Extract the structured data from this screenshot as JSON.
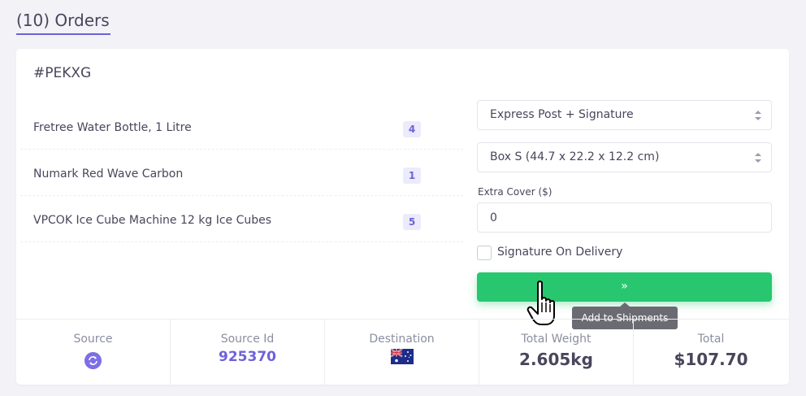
{
  "header": {
    "title": "(10) Orders"
  },
  "order": {
    "id": "#PEKXG",
    "items": [
      {
        "name": "Fretree Water Bottle, 1 Litre",
        "qty": "4"
      },
      {
        "name": "Numark Red Wave Carbon",
        "qty": "1"
      },
      {
        "name": "VPCOK Ice Cube Machine 12 kg Ice Cubes",
        "qty": "5"
      }
    ],
    "shipping_method": "Express Post + Signature",
    "box_size": "Box S (44.7 x 22.2 x 12.2 cm)",
    "extra_cover_label": "Extra Cover ($)",
    "extra_cover_value": "0",
    "signature_label": "Signature On Delivery",
    "signature_checked": false,
    "add_button_label": "»",
    "tooltip": "Add to Shipments"
  },
  "footer": {
    "source_label": "Source",
    "source_icon": "sync-icon",
    "source_id_label": "Source Id",
    "source_id": "925370",
    "destination_label": "Destination",
    "destination_flag": "australia-flag",
    "weight_label": "Total Weight",
    "weight": "2.605kg",
    "total_label": "Total",
    "total": "$107.70"
  },
  "colors": {
    "accent": "#6e62d9",
    "success": "#28c76f",
    "background": "#f2f2f7"
  }
}
